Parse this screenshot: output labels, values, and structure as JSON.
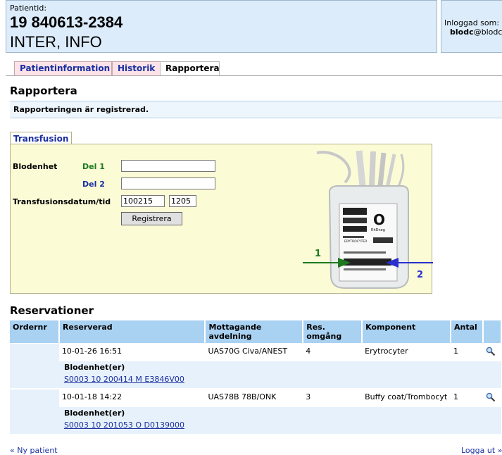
{
  "header": {
    "patient_label": "Patientid:",
    "patient_id": "19 840613-2384",
    "patient_name": "INTER, INFO",
    "login_label": "Inloggad som:",
    "login_user_bold": "blodc",
    "login_user_rest": "@blodc"
  },
  "tabs": [
    {
      "label": "Patientinformation",
      "active": false
    },
    {
      "label": "Historik",
      "active": false
    },
    {
      "label": "Rapportera",
      "active": true
    }
  ],
  "page_title": "Rapportera",
  "message": "Rapporteringen är registrerad.",
  "transfusion": {
    "tab_label": "Transfusion",
    "blodenhet_label": "Blodenhet",
    "del1_label": "Del 1",
    "del2_label": "Del 2",
    "datum_label": "Transfusionsdatum/tid",
    "del1_value": "",
    "del2_value": "",
    "date_value": "100215",
    "time_value": "1205",
    "register_button": "Registrera",
    "bag": {
      "blood_group": "O",
      "rh": "RhDneg",
      "product": "ERYTROCYTER",
      "arrow1_label": "1",
      "arrow2_label": "2"
    }
  },
  "reservations": {
    "title": "Reservationer",
    "columns": [
      "Ordernr",
      "Reserverad",
      "Mottagande avdelning",
      "Res. omgång",
      "Komponent",
      "Antal"
    ],
    "rows": [
      {
        "ordernr": "",
        "reserverad": "10-01-26 16:51",
        "avdelning": "UAS70G Civa/ANEST",
        "omgang": "4",
        "komponent": "Erytrocyter",
        "antal": "1",
        "blodenhet_title": "Blodenhet(er)",
        "blodenhet_link": "S0003 10 200414 M E3846V00"
      },
      {
        "ordernr": "",
        "reserverad": "10-01-18 14:22",
        "avdelning": "UAS78B 78B/ONK",
        "omgang": "3",
        "komponent": "Buffy coat/Trombocyt",
        "antal": "1",
        "blodenhet_title": "Blodenhet(er)",
        "blodenhet_link": "S0003 10 201053 O D0139000"
      }
    ]
  },
  "footer": {
    "left_link": "« Ny patient",
    "right_link": "Logga ut »"
  },
  "colors": {
    "header_bg": "#dcecfb",
    "tab_inactive_bg": "#fbe3e9",
    "panel_bg": "#fbfbd6",
    "table_header_bg": "#a9d1f2",
    "arrow1": "#1e7a1e",
    "arrow2": "#2a2fd0"
  }
}
